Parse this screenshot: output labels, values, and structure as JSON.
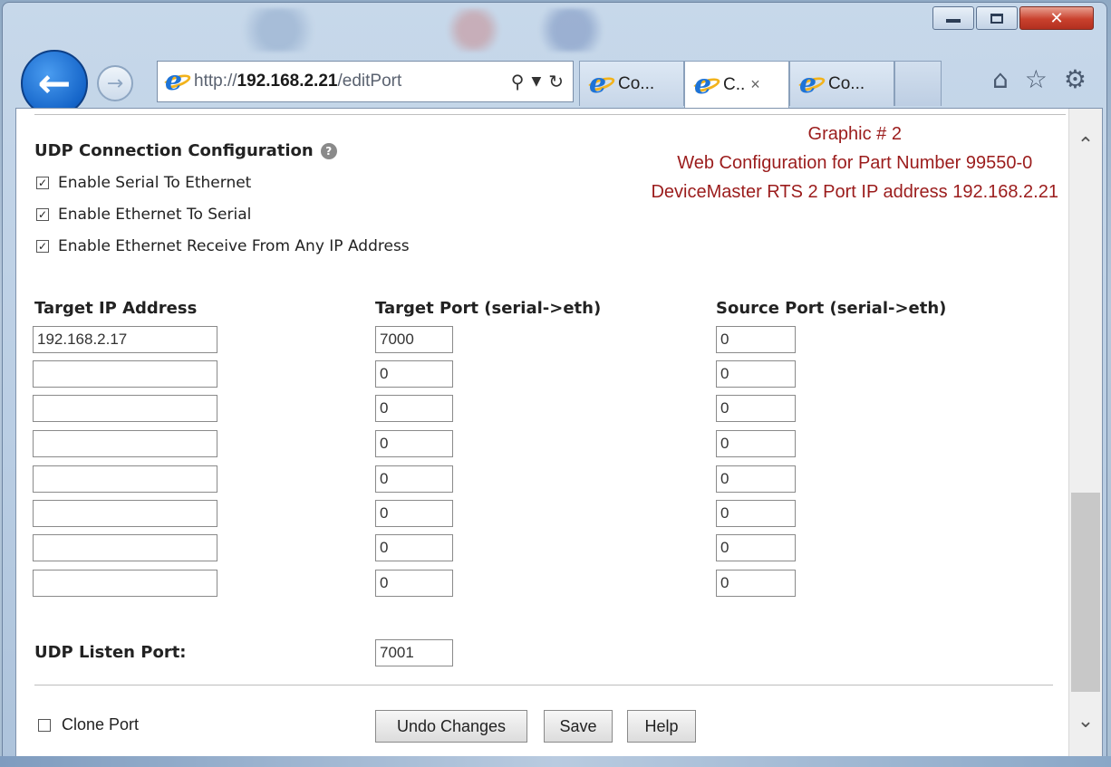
{
  "browser": {
    "url_prefix": "http://",
    "url_host": "192.168.2.21",
    "url_path": "/editPort",
    "tabs": [
      {
        "label": "Co..."
      },
      {
        "label": "C.."
      },
      {
        "label": "Co..."
      }
    ],
    "tab_close_glyph": "×"
  },
  "annotation": {
    "line1": "Graphic # 2",
    "line2": "Web Configuration for Part Number 99550-0",
    "line3": "DeviceMaster RTS 2 Port IP address 192.168.2.21",
    "color": "#9b1c1c"
  },
  "udp": {
    "title": "UDP Connection Configuration",
    "checks": [
      {
        "label": "Enable Serial To Ethernet",
        "checked": true
      },
      {
        "label": "Enable Ethernet To Serial",
        "checked": true
      },
      {
        "label": "Enable Ethernet Receive From Any IP Address",
        "checked": true
      }
    ],
    "columns": {
      "target_ip": "Target IP Address",
      "target_port": "Target Port (serial->eth)",
      "source_port": "Source Port (serial->eth)"
    },
    "rows": [
      {
        "ip": "192.168.2.17",
        "target_port": "7000",
        "source_port": "0"
      },
      {
        "ip": "",
        "target_port": "0",
        "source_port": "0"
      },
      {
        "ip": "",
        "target_port": "0",
        "source_port": "0"
      },
      {
        "ip": "",
        "target_port": "0",
        "source_port": "0"
      },
      {
        "ip": "",
        "target_port": "0",
        "source_port": "0"
      },
      {
        "ip": "",
        "target_port": "0",
        "source_port": "0"
      },
      {
        "ip": "",
        "target_port": "0",
        "source_port": "0"
      },
      {
        "ip": "",
        "target_port": "0",
        "source_port": "0"
      }
    ],
    "listen_label": "UDP Listen Port:",
    "listen_port": "7001"
  },
  "footer": {
    "clone_label": "Clone Port",
    "clone_checked": false,
    "undo_label": "Undo Changes",
    "save_label": "Save",
    "help_label": "Help"
  }
}
